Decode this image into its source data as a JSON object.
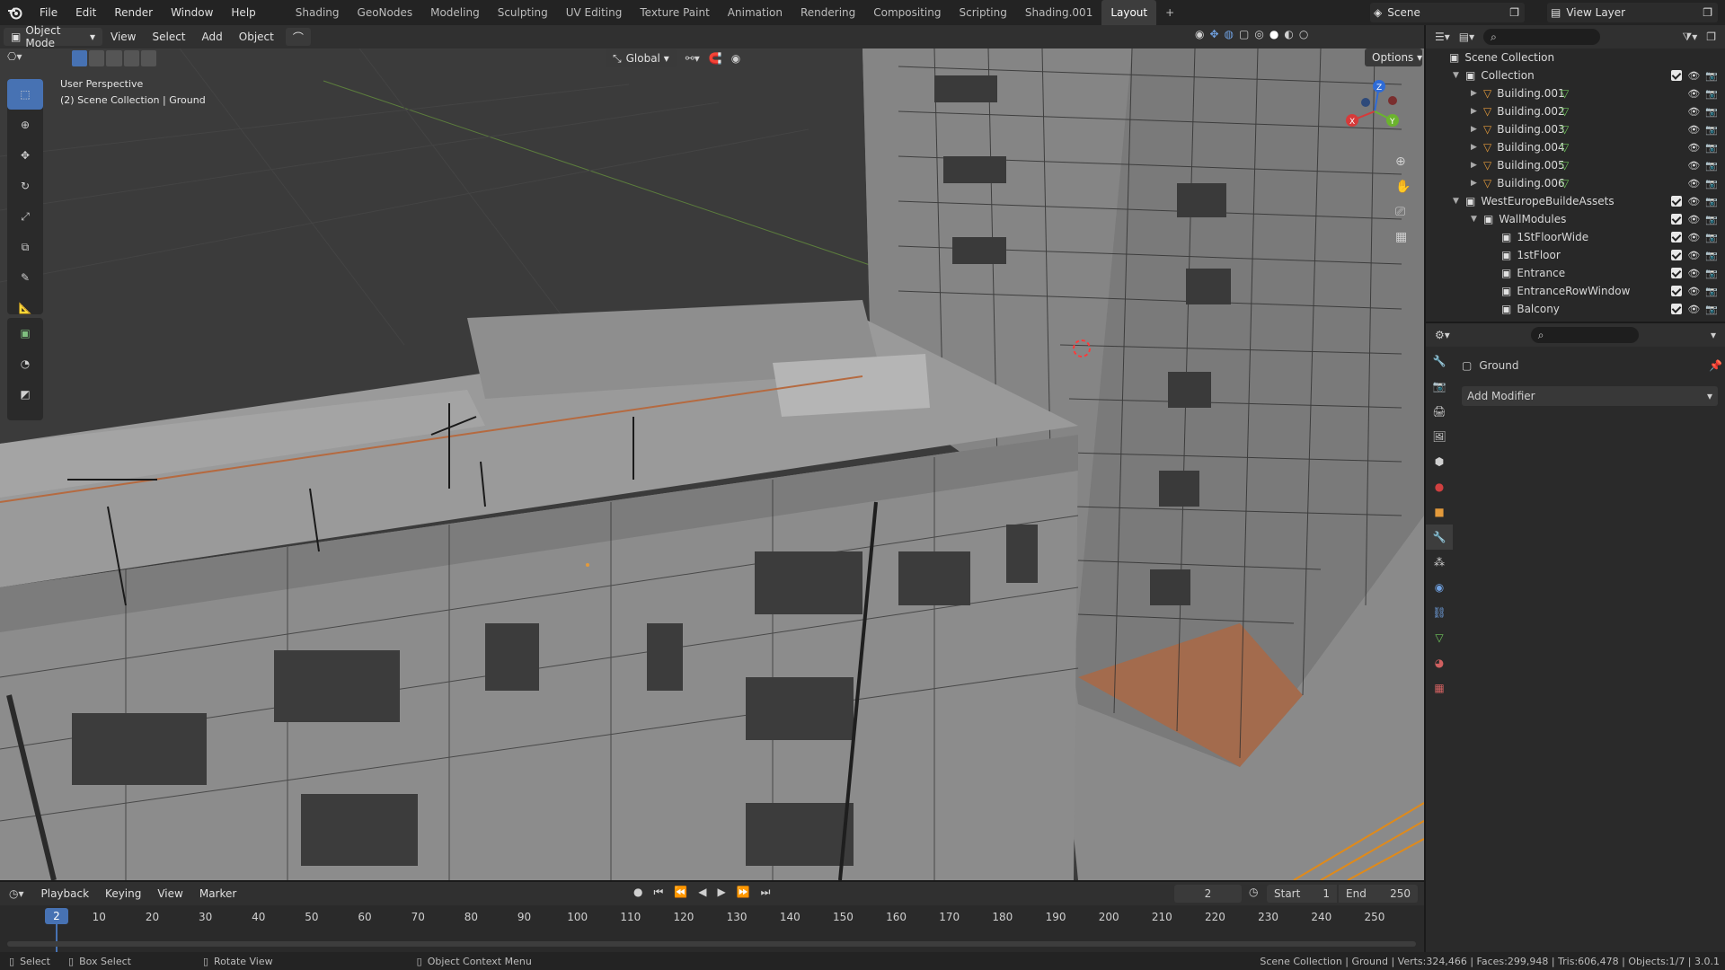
{
  "topbar": {
    "menus": [
      "File",
      "Edit",
      "Render",
      "Window",
      "Help"
    ],
    "workspaces": [
      "Shading",
      "GeoNodes",
      "Modeling",
      "Sculpting",
      "UV Editing",
      "Texture Paint",
      "Animation",
      "Rendering",
      "Compositing",
      "Scripting",
      "Shading.001",
      "Layout"
    ],
    "active_workspace": "Layout",
    "add_tab": "+",
    "scene": "Scene",
    "view_layer": "View Layer"
  },
  "viewport_header": {
    "mode": "Object Mode",
    "menus": [
      "View",
      "Select",
      "Add",
      "Object"
    ],
    "transform_orientation": "Global",
    "options": "Options"
  },
  "viewport": {
    "perspective": "User Perspective",
    "context": "(2) Scene Collection | Ground",
    "gizmo_axes": {
      "x": "X",
      "y": "Y",
      "z": "Z"
    }
  },
  "outliner": {
    "root": "Scene Collection",
    "items": [
      {
        "label": "Collection",
        "indent": 1,
        "type": "collection",
        "expanded": true
      },
      {
        "label": "Building.001",
        "indent": 2,
        "type": "object"
      },
      {
        "label": "Building.002",
        "indent": 2,
        "type": "object"
      },
      {
        "label": "Building.003",
        "indent": 2,
        "type": "object"
      },
      {
        "label": "Building.004",
        "indent": 2,
        "type": "object"
      },
      {
        "label": "Building.005",
        "indent": 2,
        "type": "object"
      },
      {
        "label": "Building.006",
        "indent": 2,
        "type": "object"
      },
      {
        "label": "WestEuropeBuildeAssets",
        "indent": 1,
        "type": "collection",
        "expanded": true
      },
      {
        "label": "WallModules",
        "indent": 2,
        "type": "collection",
        "expanded": true
      },
      {
        "label": "1StFloorWide",
        "indent": 3,
        "type": "collection"
      },
      {
        "label": "1stFloor",
        "indent": 3,
        "type": "collection"
      },
      {
        "label": "Entrance",
        "indent": 3,
        "type": "collection"
      },
      {
        "label": "EntranceRowWindow",
        "indent": 3,
        "type": "collection"
      },
      {
        "label": "Balcony",
        "indent": 3,
        "type": "collection"
      }
    ]
  },
  "properties": {
    "object_name": "Ground",
    "add_modifier": "Add Modifier"
  },
  "timeline": {
    "menus": [
      "Playback",
      "Keying",
      "View",
      "Marker"
    ],
    "current_frame": "2",
    "start_label": "Start",
    "start": "1",
    "end_label": "End",
    "end": "250",
    "ticks": [
      "10",
      "20",
      "30",
      "40",
      "50",
      "60",
      "70",
      "80",
      "90",
      "100",
      "110",
      "120",
      "130",
      "140",
      "150",
      "160",
      "170",
      "180",
      "190",
      "200",
      "210",
      "220",
      "230",
      "240",
      "250"
    ]
  },
  "statusbar": {
    "select": "Select",
    "box_select": "Box Select",
    "rotate_view": "Rotate View",
    "context_menu": "Object Context Menu",
    "stats": "Scene Collection | Ground | Verts:324,466 | Faces:299,948 | Tris:606,478 | Objects:1/7 | 3.0.1"
  },
  "colors": {
    "accent": "#4772b3",
    "collection_checkbox": "#e8e8e8",
    "object_orange": "#e39a3b",
    "mesh_green": "#6fc65b"
  }
}
